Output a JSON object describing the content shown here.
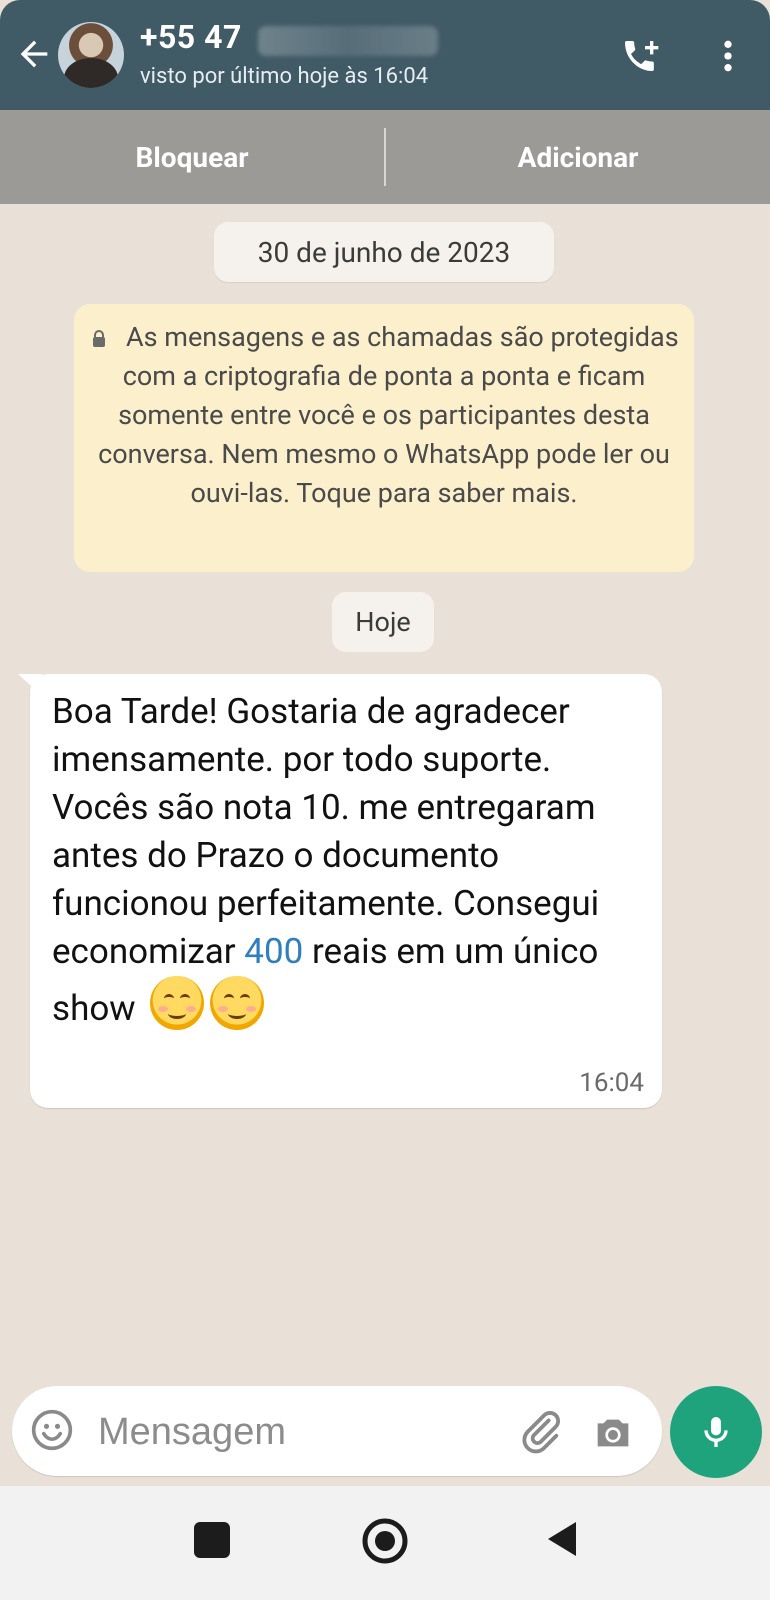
{
  "header": {
    "contact": "+55 47",
    "last_seen": "visto por último hoje às 16:04"
  },
  "actions": {
    "block": "Bloquear",
    "add": "Adicionar"
  },
  "chat": {
    "date_chip": "30 de junho de 2023",
    "encryption_text": "As mensagens e as chamadas são protegidas com a criptografia de ponta a ponta e ficam somente entre você e os participantes desta conversa. Nem mesmo o WhatsApp pode ler ou ouvi-las. Toque para saber mais.",
    "today_chip": "Hoje",
    "message": {
      "before": "Boa Tarde! Gostaria de agradecer imensamente. por todo suporte. Vocês são nota 10. me entregaram antes do Prazo o documento funcionou perfeitamente. Consegui economizar ",
      "highlight": "400",
      "after": " reais em um único show",
      "time": "16:04"
    }
  },
  "composer": {
    "placeholder": "Mensagem"
  },
  "colors": {
    "header_bg": "#405a66",
    "actionbar_bg": "#9c9a96",
    "chat_bg": "#e9e1d7",
    "encryption_bg": "#fbefcc",
    "mic_bg": "#1fa37d"
  }
}
